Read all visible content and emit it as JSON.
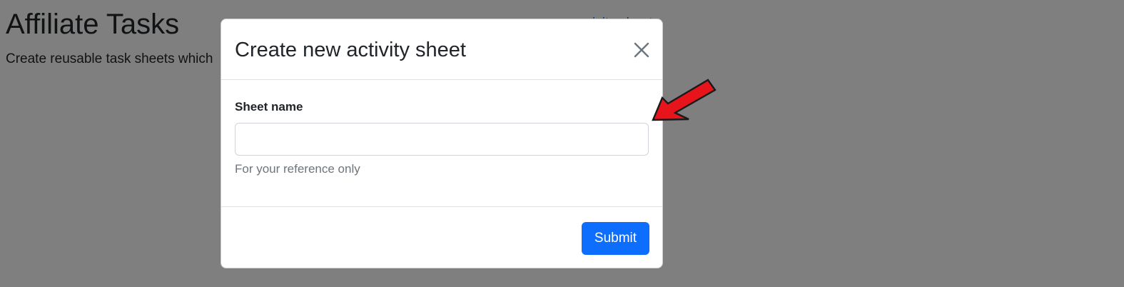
{
  "page": {
    "title": "Affiliate Tasks",
    "subtitle": "Create reusable task sheets which",
    "link_partial": "ivity sheet"
  },
  "modal": {
    "title": "Create new activity sheet",
    "close_icon": "close-icon",
    "field": {
      "label": "Sheet name",
      "value": "",
      "placeholder": "",
      "help": "For your reference only"
    },
    "submit_label": "Submit"
  },
  "annotation": {
    "icon": "arrow-icon",
    "color": "#e8141c"
  },
  "colors": {
    "accent": "#0d6efd",
    "backdrop": "rgba(0,0,0,0.5)"
  }
}
